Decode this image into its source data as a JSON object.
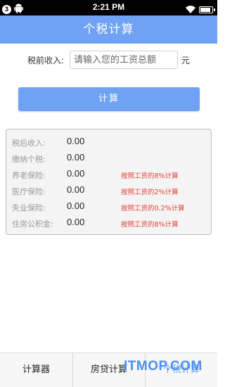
{
  "status_bar": {
    "notification_count": "3",
    "time": "2:21 PM"
  },
  "header": {
    "title": "个税计算"
  },
  "form": {
    "label": "税前收入:",
    "placeholder": "请输入您的工资总额",
    "value": "",
    "unit": "元",
    "button_label": "计算"
  },
  "results": [
    {
      "label": "税后收入:",
      "value": "0.00",
      "note": ""
    },
    {
      "label": "缴纳个税:",
      "value": "0.00",
      "note": ""
    },
    {
      "label": "养老保险:",
      "value": "0.00",
      "note": "按照工资的8%计算"
    },
    {
      "label": "医疗保险:",
      "value": "0.00",
      "note": "按照工资的2%计算"
    },
    {
      "label": "失业保险:",
      "value": "0.00",
      "note": "按照工资的0.2%计算"
    },
    {
      "label": "住房公积金:",
      "value": "0.00",
      "note": "按照工资的8%计算"
    }
  ],
  "tabs": [
    {
      "label": "计算器"
    },
    {
      "label": "房贷计算"
    },
    {
      "label": "个税计算"
    }
  ],
  "watermark": "ITMOP.COM",
  "colors": {
    "accent": "#6fa2f5",
    "note_red": "#e0443a"
  }
}
